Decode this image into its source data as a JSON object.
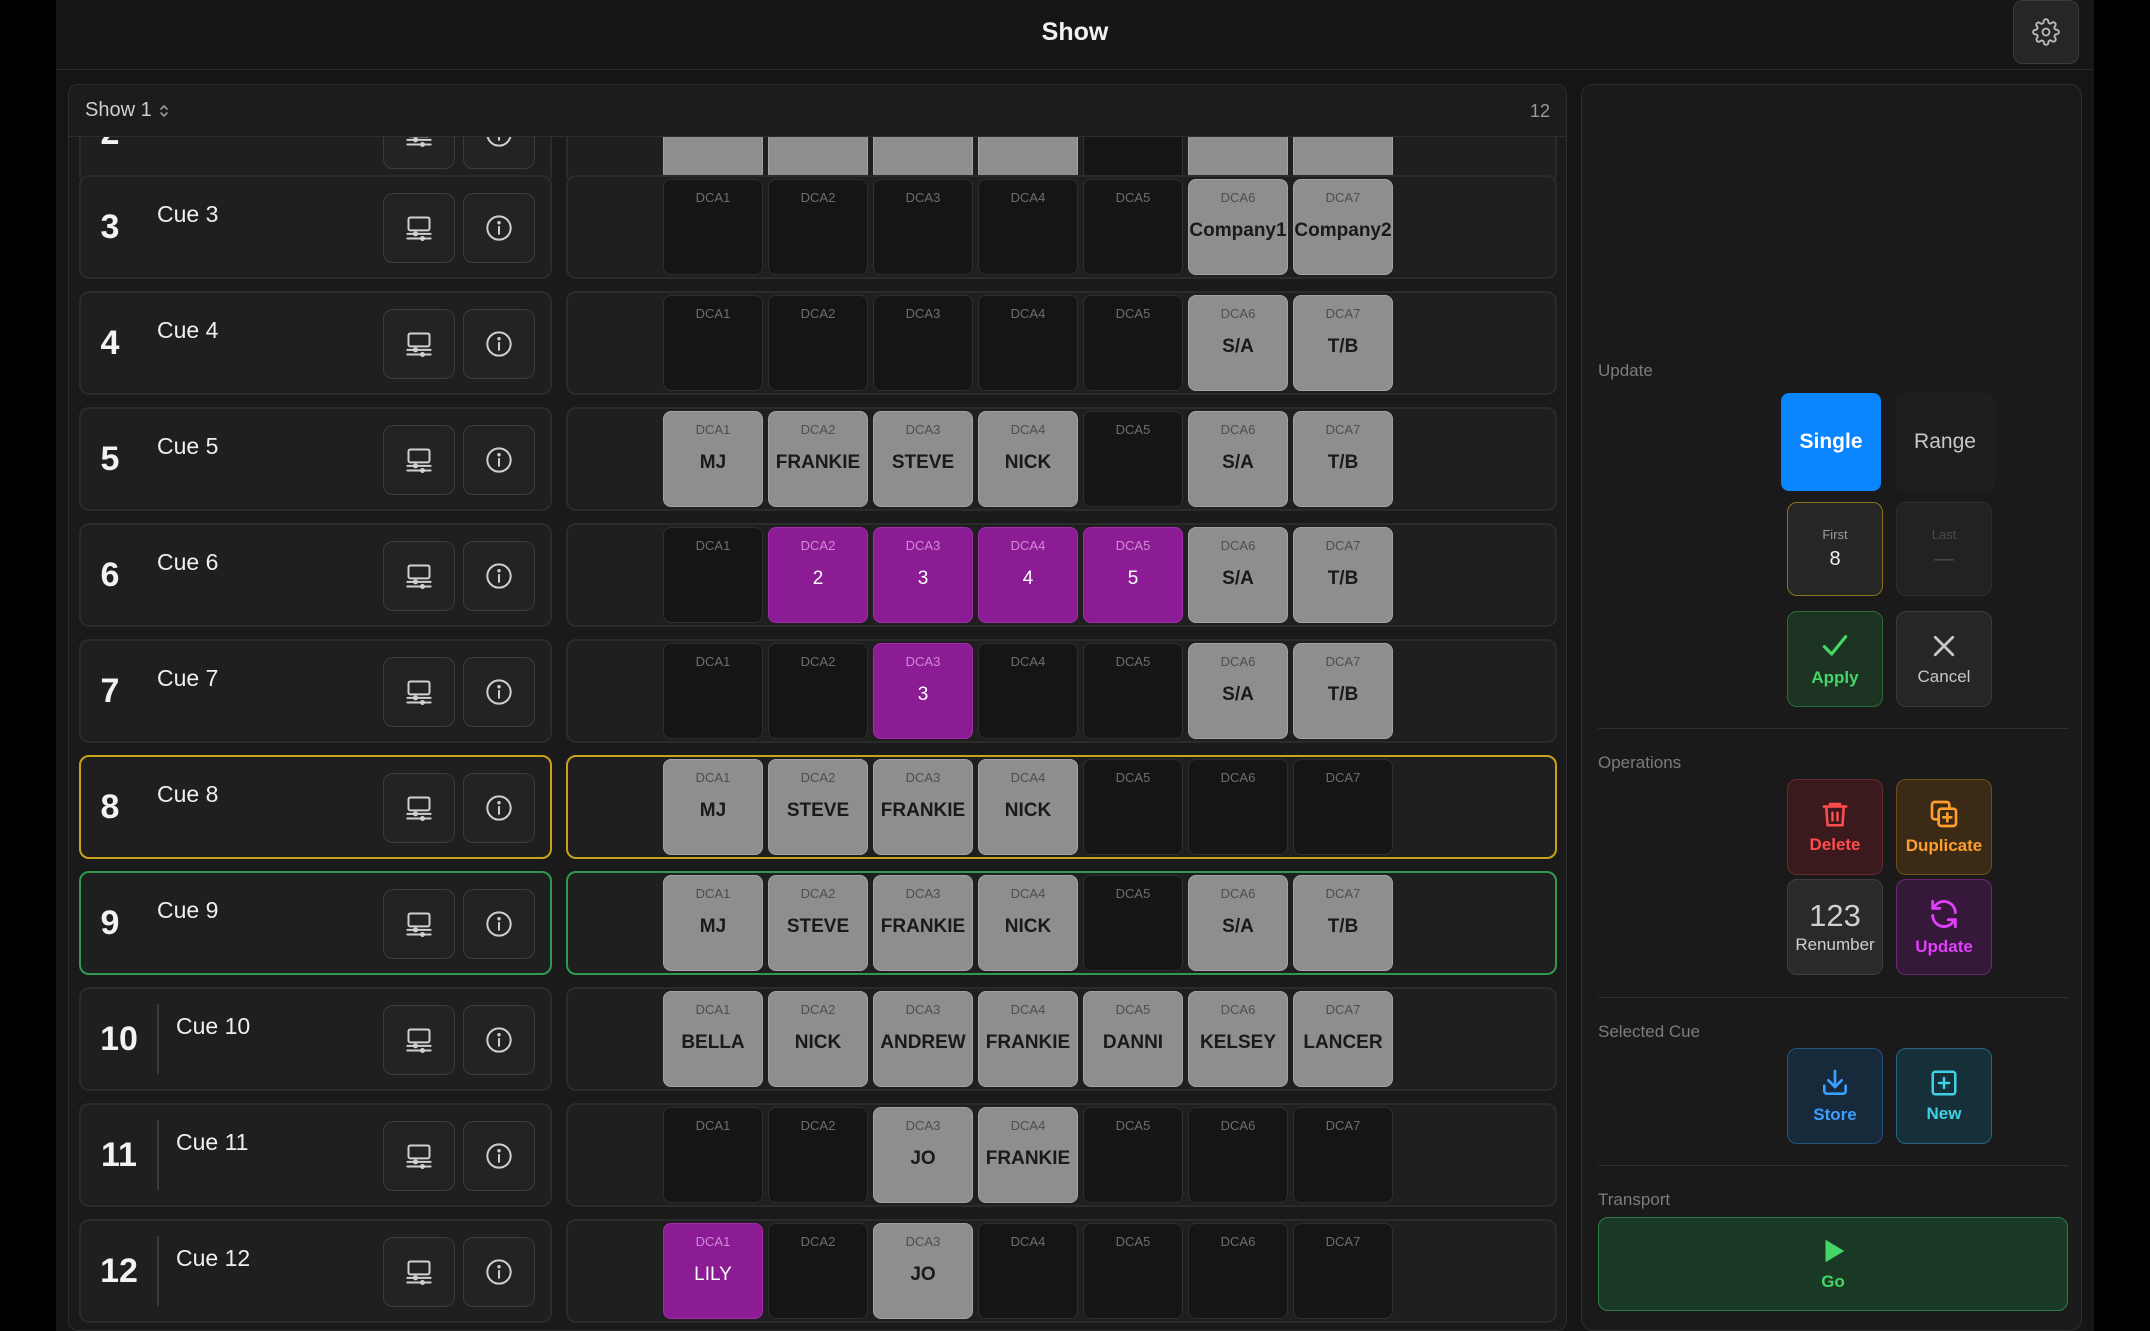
{
  "header": {
    "title": "Show"
  },
  "show": {
    "name": "Show 1",
    "cue_count": "12"
  },
  "cues": [
    {
      "number": "2",
      "name": "",
      "partial": true,
      "dcas": [
        {
          "label": "",
          "value": "",
          "state": "gray"
        },
        {
          "label": "",
          "value": "",
          "state": "gray"
        },
        {
          "label": "",
          "value": "",
          "state": "gray"
        },
        {
          "label": "",
          "value": "",
          "state": "gray"
        },
        {
          "label": "",
          "value": "",
          "state": "empty"
        },
        {
          "label": "",
          "value": "",
          "state": "gray"
        },
        {
          "label": "",
          "value": "",
          "state": "gray"
        }
      ]
    },
    {
      "number": "3",
      "name": "Cue 3",
      "dcas": [
        {
          "label": "DCA1",
          "value": "",
          "state": "empty"
        },
        {
          "label": "DCA2",
          "value": "",
          "state": "empty"
        },
        {
          "label": "DCA3",
          "value": "",
          "state": "empty"
        },
        {
          "label": "DCA4",
          "value": "",
          "state": "empty"
        },
        {
          "label": "DCA5",
          "value": "",
          "state": "empty"
        },
        {
          "label": "DCA6",
          "value": "Company1",
          "state": "gray"
        },
        {
          "label": "DCA7",
          "value": "Company2",
          "state": "gray"
        }
      ]
    },
    {
      "number": "4",
      "name": "Cue 4",
      "dcas": [
        {
          "label": "DCA1",
          "value": "",
          "state": "empty"
        },
        {
          "label": "DCA2",
          "value": "",
          "state": "empty"
        },
        {
          "label": "DCA3",
          "value": "",
          "state": "empty"
        },
        {
          "label": "DCA4",
          "value": "",
          "state": "empty"
        },
        {
          "label": "DCA5",
          "value": "",
          "state": "empty"
        },
        {
          "label": "DCA6",
          "value": "S/A",
          "state": "gray"
        },
        {
          "label": "DCA7",
          "value": "T/B",
          "state": "gray"
        }
      ]
    },
    {
      "number": "5",
      "name": "Cue 5",
      "dcas": [
        {
          "label": "DCA1",
          "value": "MJ",
          "state": "gray"
        },
        {
          "label": "DCA2",
          "value": "FRANKIE",
          "state": "gray"
        },
        {
          "label": "DCA3",
          "value": "STEVE",
          "state": "gray"
        },
        {
          "label": "DCA4",
          "value": "NICK",
          "state": "gray"
        },
        {
          "label": "DCA5",
          "value": "",
          "state": "empty"
        },
        {
          "label": "DCA6",
          "value": "S/A",
          "state": "gray"
        },
        {
          "label": "DCA7",
          "value": "T/B",
          "state": "gray"
        }
      ]
    },
    {
      "number": "6",
      "name": "Cue 6",
      "dcas": [
        {
          "label": "DCA1",
          "value": "",
          "state": "empty"
        },
        {
          "label": "DCA2",
          "value": "2",
          "state": "purple"
        },
        {
          "label": "DCA3",
          "value": "3",
          "state": "purple"
        },
        {
          "label": "DCA4",
          "value": "4",
          "state": "purple"
        },
        {
          "label": "DCA5",
          "value": "5",
          "state": "purple"
        },
        {
          "label": "DCA6",
          "value": "S/A",
          "state": "gray"
        },
        {
          "label": "DCA7",
          "value": "T/B",
          "state": "gray"
        }
      ]
    },
    {
      "number": "7",
      "name": "Cue 7",
      "dcas": [
        {
          "label": "DCA1",
          "value": "",
          "state": "empty"
        },
        {
          "label": "DCA2",
          "value": "",
          "state": "empty"
        },
        {
          "label": "DCA3",
          "value": "3",
          "state": "purple"
        },
        {
          "label": "DCA4",
          "value": "",
          "state": "empty"
        },
        {
          "label": "DCA5",
          "value": "",
          "state": "empty"
        },
        {
          "label": "DCA6",
          "value": "S/A",
          "state": "gray"
        },
        {
          "label": "DCA7",
          "value": "T/B",
          "state": "gray"
        }
      ]
    },
    {
      "number": "8",
      "name": "Cue 8",
      "highlight": "yellow",
      "dcas": [
        {
          "label": "DCA1",
          "value": "MJ",
          "state": "gray"
        },
        {
          "label": "DCA2",
          "value": "STEVE",
          "state": "gray"
        },
        {
          "label": "DCA3",
          "value": "FRANKIE",
          "state": "gray"
        },
        {
          "label": "DCA4",
          "value": "NICK",
          "state": "gray"
        },
        {
          "label": "DCA5",
          "value": "",
          "state": "empty"
        },
        {
          "label": "DCA6",
          "value": "",
          "state": "empty"
        },
        {
          "label": "DCA7",
          "value": "",
          "state": "empty"
        }
      ]
    },
    {
      "number": "9",
      "name": "Cue 9",
      "highlight": "green",
      "dcas": [
        {
          "label": "DCA1",
          "value": "MJ",
          "state": "gray"
        },
        {
          "label": "DCA2",
          "value": "STEVE",
          "state": "gray"
        },
        {
          "label": "DCA3",
          "value": "FRANKIE",
          "state": "gray"
        },
        {
          "label": "DCA4",
          "value": "NICK",
          "state": "gray"
        },
        {
          "label": "DCA5",
          "value": "",
          "state": "empty"
        },
        {
          "label": "DCA6",
          "value": "S/A",
          "state": "gray"
        },
        {
          "label": "DCA7",
          "value": "T/B",
          "state": "gray"
        }
      ]
    },
    {
      "number": "10",
      "name": "Cue 10",
      "dcas": [
        {
          "label": "DCA1",
          "value": "BELLA",
          "state": "gray"
        },
        {
          "label": "DCA2",
          "value": "NICK",
          "state": "gray"
        },
        {
          "label": "DCA3",
          "value": "ANDREW",
          "state": "gray"
        },
        {
          "label": "DCA4",
          "value": "FRANKIE",
          "state": "gray"
        },
        {
          "label": "DCA5",
          "value": "DANNI",
          "state": "gray"
        },
        {
          "label": "DCA6",
          "value": "KELSEY",
          "state": "gray"
        },
        {
          "label": "DCA7",
          "value": "LANCER",
          "state": "gray"
        }
      ]
    },
    {
      "number": "11",
      "name": "Cue 11",
      "dcas": [
        {
          "label": "DCA1",
          "value": "",
          "state": "empty"
        },
        {
          "label": "DCA2",
          "value": "",
          "state": "empty"
        },
        {
          "label": "DCA3",
          "value": "JO",
          "state": "gray"
        },
        {
          "label": "DCA4",
          "value": "FRANKIE",
          "state": "gray"
        },
        {
          "label": "DCA5",
          "value": "",
          "state": "empty"
        },
        {
          "label": "DCA6",
          "value": "",
          "state": "empty"
        },
        {
          "label": "DCA7",
          "value": "",
          "state": "empty"
        }
      ]
    },
    {
      "number": "12",
      "name": "Cue 12",
      "dcas": [
        {
          "label": "DCA1",
          "value": "LILY",
          "state": "purple"
        },
        {
          "label": "DCA2",
          "value": "",
          "state": "empty"
        },
        {
          "label": "DCA3",
          "value": "JO",
          "state": "gray"
        },
        {
          "label": "DCA4",
          "value": "",
          "state": "empty"
        },
        {
          "label": "DCA5",
          "value": "",
          "state": "empty"
        },
        {
          "label": "DCA6",
          "value": "",
          "state": "empty"
        },
        {
          "label": "DCA7",
          "value": "",
          "state": "empty"
        }
      ]
    }
  ],
  "side": {
    "update": {
      "label": "Update",
      "single": "Single",
      "range": "Range",
      "first_label": "First",
      "first_value": "8",
      "last_label": "Last",
      "last_value": "—",
      "apply": "Apply",
      "cancel": "Cancel"
    },
    "operations": {
      "label": "Operations",
      "delete": "Delete",
      "duplicate": "Duplicate",
      "renumber_glyph": "123",
      "renumber": "Renumber",
      "update": "Update"
    },
    "selected_cue": {
      "label": "Selected Cue",
      "store": "Store",
      "new": "New"
    },
    "transport": {
      "label": "Transport",
      "go": "Go"
    }
  },
  "colors": {
    "accent_blue": "#0a84ff",
    "selected_yellow": "#c8a21d",
    "active_green": "#2f9a4e",
    "dca_purple": "#8b1c94",
    "delete_red": "#ff4d4d",
    "duplicate_orange": "#ff9e2c",
    "update_magenta": "#e040fb",
    "store_blue": "#3aa0ff",
    "new_cyan": "#3fd2e6",
    "go_green": "#45d66a"
  },
  "icons": {
    "gear": "gear-icon",
    "monitor": "monitor-sliders-icon",
    "info": "info-icon",
    "checkmark": "checkmark-icon",
    "x": "close-icon",
    "trash": "trash-icon",
    "duplicate": "duplicate-icon",
    "refresh": "refresh-icon",
    "download": "download-icon",
    "plus": "plus-square-icon",
    "play": "play-icon"
  }
}
